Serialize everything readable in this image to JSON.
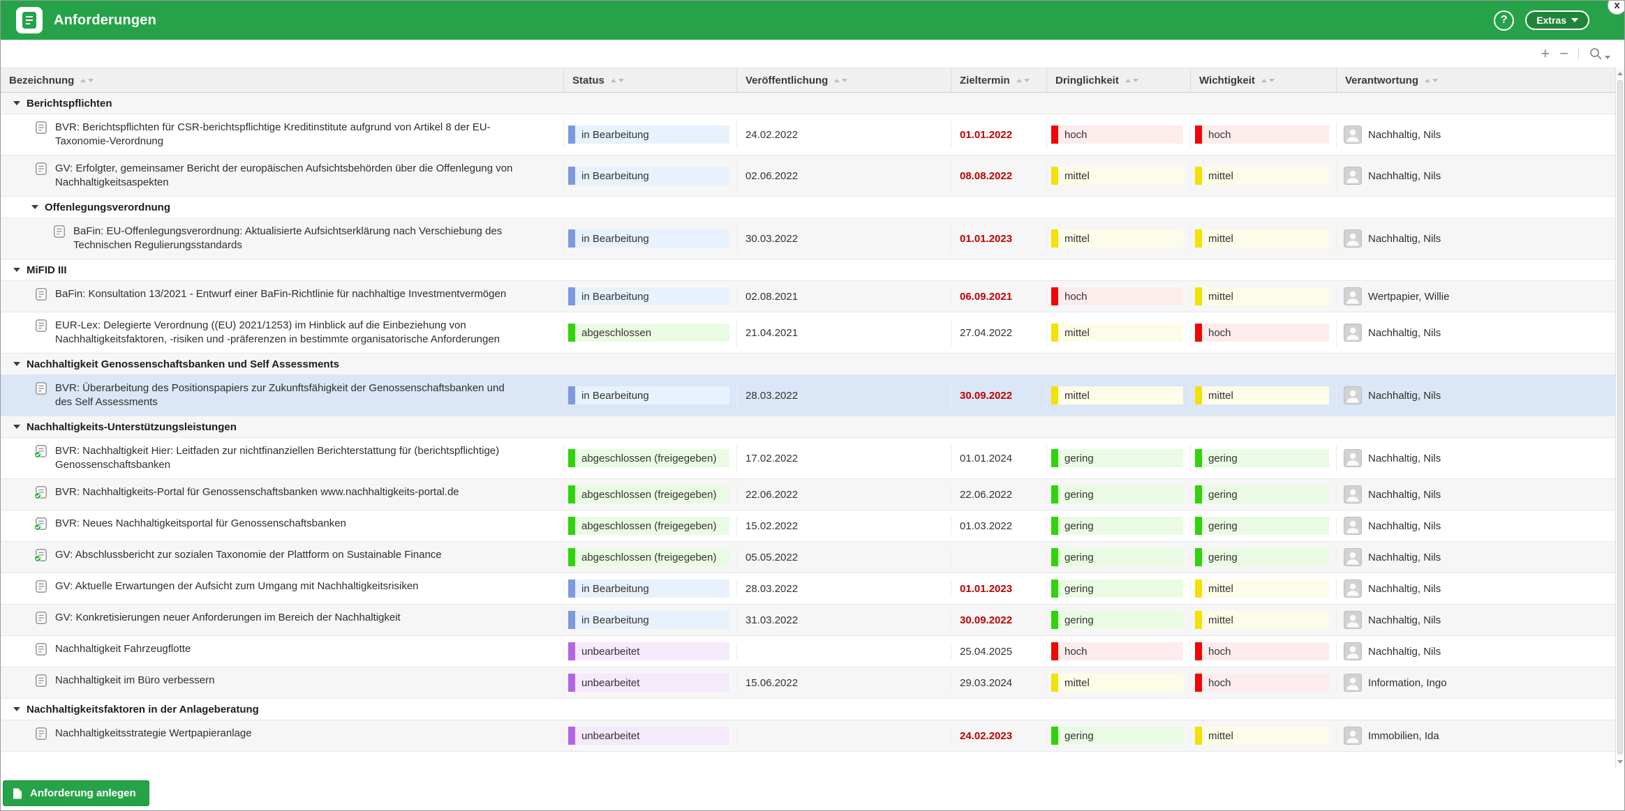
{
  "window": {
    "title": "Anforderungen",
    "help_label": "?",
    "extras_label": "Extras",
    "close_label": "x"
  },
  "toolbar": {
    "plus": "+",
    "minus": "−"
  },
  "table": {
    "columns": [
      {
        "key": "bezeichnung",
        "label": "Bezeichnung"
      },
      {
        "key": "status",
        "label": "Status"
      },
      {
        "key": "veroeffentlichung",
        "label": "Veröffentlichung"
      },
      {
        "key": "zieltermin",
        "label": "Zieltermin"
      },
      {
        "key": "dringlichkeit",
        "label": "Dringlichkeit"
      },
      {
        "key": "wichtigkeit",
        "label": "Wichtigkeit"
      },
      {
        "key": "verantwortung",
        "label": "Verantwortung"
      }
    ],
    "rows": [
      {
        "type": "group",
        "level": 0,
        "label": "Berichtspflichten"
      },
      {
        "type": "item",
        "level": 1,
        "title": "BVR: Berichtspflichten für CSR-berichtspflichtige Kreditinstitute aufgrund von Artikel 8 der EU-Taxonomie-Verordnung",
        "status_key": "in_bearbeitung",
        "status_label": "in Bearbeitung",
        "published": "24.02.2022",
        "due": "01.01.2022",
        "due_overdue": true,
        "urgency": "hoch",
        "importance": "hoch",
        "owner": "Nachhaltig, Nils",
        "checked": false,
        "selected": false
      },
      {
        "type": "item",
        "level": 1,
        "title": "GV: Erfolgter, gemeinsamer Bericht der europäischen Aufsichtsbehörden über die Offenlegung von Nachhaltigkeitsaspekten",
        "status_key": "in_bearbeitung",
        "status_label": "in Bearbeitung",
        "published": "02.06.2022",
        "due": "08.08.2022",
        "due_overdue": true,
        "urgency": "mittel",
        "importance": "mittel",
        "owner": "Nachhaltig, Nils",
        "checked": false,
        "selected": false
      },
      {
        "type": "group",
        "level": 1,
        "label": "Offenlegungsverordnung"
      },
      {
        "type": "item",
        "level": 2,
        "title": "BaFin: EU-Offenlegungsverordnung: Aktualisierte Aufsichtserklärung nach Verschiebung des Technischen Regulierungsstandards",
        "status_key": "in_bearbeitung",
        "status_label": "in Bearbeitung",
        "published": "30.03.2022",
        "due": "01.01.2023",
        "due_overdue": true,
        "urgency": "mittel",
        "importance": "mittel",
        "owner": "Nachhaltig, Nils",
        "checked": false,
        "selected": false
      },
      {
        "type": "group",
        "level": 0,
        "label": "MiFID III"
      },
      {
        "type": "item",
        "level": 1,
        "title": "BaFin: Konsultation 13/2021 - Entwurf einer BaFin-Richtlinie für nachhaltige Investmentvermögen",
        "status_key": "in_bearbeitung",
        "status_label": "in Bearbeitung",
        "published": "02.08.2021",
        "due": "06.09.2021",
        "due_overdue": true,
        "urgency": "hoch",
        "importance": "mittel",
        "owner": "Wertpapier, Willie",
        "checked": false,
        "selected": false
      },
      {
        "type": "item",
        "level": 1,
        "title": "EUR-Lex: Delegierte Verordnung ((EU) 2021/1253) im Hinblick auf die Einbeziehung von Nachhaltigkeitsfaktoren, -risiken und -präferenzen in bestimmte organisatorische Anforderungen",
        "status_key": "abgeschlossen",
        "status_label": "abgeschlossen",
        "published": "21.04.2021",
        "due": "27.04.2022",
        "due_overdue": false,
        "urgency": "mittel",
        "importance": "hoch",
        "owner": "Nachhaltig, Nils",
        "checked": false,
        "selected": false
      },
      {
        "type": "group",
        "level": 0,
        "label": "Nachhaltigkeit Genossenschaftsbanken und Self Assessments"
      },
      {
        "type": "item",
        "level": 1,
        "title": "BVR: Überarbeitung des Positionspapiers zur Zukunftsfähigkeit der Genossenschaftsbanken und des Self Assessments",
        "status_key": "in_bearbeitung",
        "status_label": "in Bearbeitung",
        "published": "28.03.2022",
        "due": "30.09.2022",
        "due_overdue": true,
        "urgency": "mittel",
        "importance": "mittel",
        "owner": "Nachhaltig, Nils",
        "checked": false,
        "selected": true
      },
      {
        "type": "group",
        "level": 0,
        "label": "Nachhaltigkeits-Unterstützungsleistungen"
      },
      {
        "type": "item",
        "level": 1,
        "title": "BVR: Nachhaltigkeit Hier: Leitfaden zur nichtfinanziellen Berichterstattung für (berichtspflichtige) Genossenschaftsbanken",
        "status_key": "abgeschlossen",
        "status_label": "abgeschlossen (freigegeben)",
        "published": "17.02.2022",
        "due": "01.01.2024",
        "due_overdue": false,
        "urgency": "gering",
        "importance": "gering",
        "owner": "Nachhaltig, Nils",
        "checked": true,
        "selected": false
      },
      {
        "type": "item",
        "level": 1,
        "title": "BVR: Nachhaltigkeits-Portal für Genossenschaftsbanken www.nachhaltigkeits-portal.de",
        "status_key": "abgeschlossen",
        "status_label": "abgeschlossen (freigegeben)",
        "published": "22.06.2022",
        "due": "22.06.2022",
        "due_overdue": false,
        "urgency": "gering",
        "importance": "gering",
        "owner": "Nachhaltig, Nils",
        "checked": true,
        "selected": false
      },
      {
        "type": "item",
        "level": 1,
        "title": "BVR: Neues Nachhaltigkeitsportal für Genossenschaftsbanken",
        "status_key": "abgeschlossen",
        "status_label": "abgeschlossen (freigegeben)",
        "published": "15.02.2022",
        "due": "01.03.2022",
        "due_overdue": false,
        "urgency": "gering",
        "importance": "gering",
        "owner": "Nachhaltig, Nils",
        "checked": true,
        "selected": false
      },
      {
        "type": "item",
        "level": 1,
        "title": "GV: Abschlussbericht zur sozialen Taxonomie der Plattform on Sustainable Finance",
        "status_key": "abgeschlossen",
        "status_label": "abgeschlossen (freigegeben)",
        "published": "05.05.2022",
        "due": "",
        "due_overdue": false,
        "urgency": "gering",
        "importance": "gering",
        "owner": "Nachhaltig, Nils",
        "checked": true,
        "selected": false
      },
      {
        "type": "item",
        "level": 1,
        "title": "GV: Aktuelle Erwartungen der Aufsicht zum Umgang mit Nachhaltigkeitsrisiken",
        "status_key": "in_bearbeitung",
        "status_label": "in Bearbeitung",
        "published": "28.03.2022",
        "due": "01.01.2023",
        "due_overdue": true,
        "urgency": "gering",
        "importance": "mittel",
        "owner": "Nachhaltig, Nils",
        "checked": false,
        "selected": false
      },
      {
        "type": "item",
        "level": 1,
        "title": "GV: Konkretisierungen neuer Anforderungen im Bereich der Nachhaltigkeit",
        "status_key": "in_bearbeitung",
        "status_label": "in Bearbeitung",
        "published": "31.03.2022",
        "due": "30.09.2022",
        "due_overdue": true,
        "urgency": "gering",
        "importance": "mittel",
        "owner": "Nachhaltig, Nils",
        "checked": false,
        "selected": false
      },
      {
        "type": "item",
        "level": 1,
        "title": "Nachhaltigkeit Fahrzeugflotte",
        "status_key": "unbearbeitet",
        "status_label": "unbearbeitet",
        "published": "",
        "due": "25.04.2025",
        "due_overdue": false,
        "urgency": "hoch",
        "importance": "hoch",
        "owner": "Nachhaltig, Nils",
        "checked": false,
        "selected": false
      },
      {
        "type": "item",
        "level": 1,
        "title": "Nachhaltigkeit im Büro verbessern",
        "status_key": "unbearbeitet",
        "status_label": "unbearbeitet",
        "published": "15.06.2022",
        "due": "29.03.2024",
        "due_overdue": false,
        "urgency": "mittel",
        "importance": "hoch",
        "owner": "Information, Ingo",
        "checked": false,
        "selected": false
      },
      {
        "type": "group",
        "level": 0,
        "label": "Nachhaltigkeitsfaktoren in der Anlageberatung"
      },
      {
        "type": "item",
        "level": 1,
        "title": "Nachhaltigkeitsstrategie Wertpapieranlage",
        "status_key": "unbearbeitet",
        "status_label": "unbearbeitet",
        "published": "",
        "due": "24.02.2023",
        "due_overdue": true,
        "urgency": "gering",
        "importance": "mittel",
        "owner": "Immobilien, Ida",
        "checked": false,
        "selected": false
      }
    ]
  },
  "footer": {
    "create_button_label": "Anforderung anlegen"
  },
  "colors": {
    "header_green": "#26a348",
    "overdue_text": "#c10000",
    "status": {
      "in_bearbeitung": {
        "bar": "#7e99e0",
        "bg": "#e7f2fd"
      },
      "abgeschlossen": {
        "bar": "#2fd40a",
        "bg": "#eafbe4"
      },
      "unbearbeitet": {
        "bar": "#b564e4",
        "bg": "#f5e9fc"
      }
    },
    "priority": {
      "hoch": {
        "bar": "#f20505",
        "bg": "#fdecec"
      },
      "mittel": {
        "bar": "#f2e205",
        "bg": "#fdfce8"
      },
      "gering": {
        "bar": "#2fd40a",
        "bg": "#eafbe4"
      }
    }
  }
}
